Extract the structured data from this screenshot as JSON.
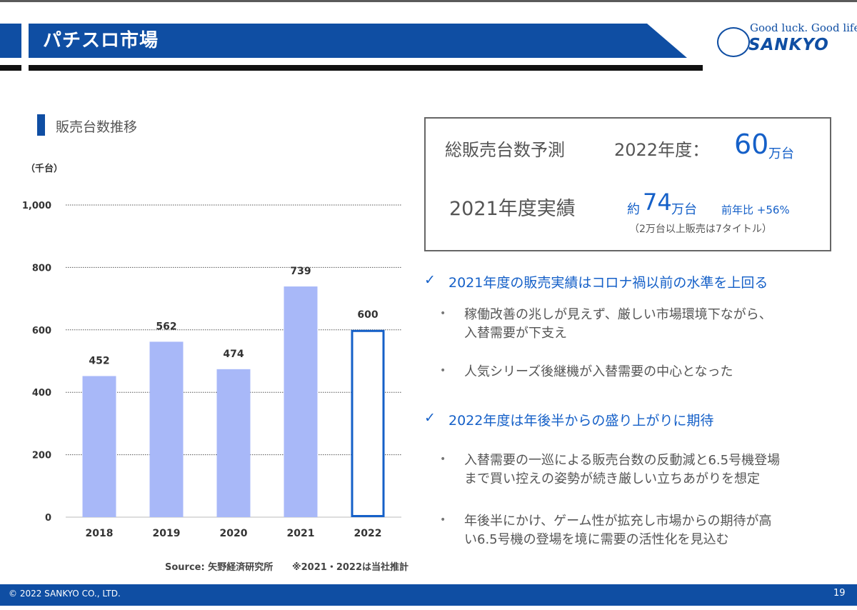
{
  "header": {
    "title": "パチスロ市場",
    "logo_tagline": "Good luck. Good life.",
    "logo_name": "SANKYO"
  },
  "chart_section": {
    "title": "販売台数推移",
    "unit": "（千台）",
    "source": "Source: 矢野経済研究所",
    "note": "※2021・2022は当社推計"
  },
  "chart_data": {
    "type": "bar",
    "categories": [
      "2018",
      "2019",
      "2020",
      "2021",
      "2022"
    ],
    "values": [
      452,
      562,
      474,
      739,
      600
    ],
    "data_labels": [
      "452",
      "562",
      "474",
      "739",
      "600"
    ],
    "ylim": [
      0,
      1000
    ],
    "yticks": [
      "0",
      "200",
      "400",
      "600",
      "800",
      "1,000"
    ],
    "ytick_values": [
      0,
      200,
      400,
      600,
      800,
      1000
    ],
    "ylabel": "（千台）",
    "xlabel": "",
    "grid": true,
    "bar_color": "#a8b8f8",
    "forecast_index": 4,
    "forecast_color": "#1560c8"
  },
  "summary": {
    "line1_label": "総販売台数予測",
    "line1_year": "2022年度：",
    "line1_value": "60",
    "line1_unit": "万台",
    "line2_label": "2021年度実績",
    "line2_prefix": "約",
    "line2_value": "74",
    "line2_unit": "万台",
    "line2_yoy": "前年比 +56%",
    "line2_note": "（2万台以上販売は7タイトル）"
  },
  "points": [
    {
      "check": "✓",
      "title": "2021年度の販売実績はコロナ禍以前の水準を上回る",
      "bullets": [
        [
          "稼働改善の兆しが見えず、厳しい市場環境下ながら、",
          "入替需要が下支え"
        ],
        [
          "人気シリーズ後継機が入替需要の中心となった"
        ]
      ]
    },
    {
      "check": "✓",
      "title": "2022年度は年後半からの盛り上がりに期待",
      "bullets": [
        [
          "入替需要の一巡による販売台数の反動減と6.5号機登場",
          "まで買い控えの姿勢が続き厳しい立ちあがりを想定"
        ],
        [
          "年後半にかけ、ゲーム性が拡充し市場からの期待が高",
          "い6.5号機の登場を境に需要の活性化を見込む"
        ]
      ]
    }
  ],
  "footer": {
    "copyright": "© 2022 SANKYO CO., LTD.",
    "page": "19"
  }
}
